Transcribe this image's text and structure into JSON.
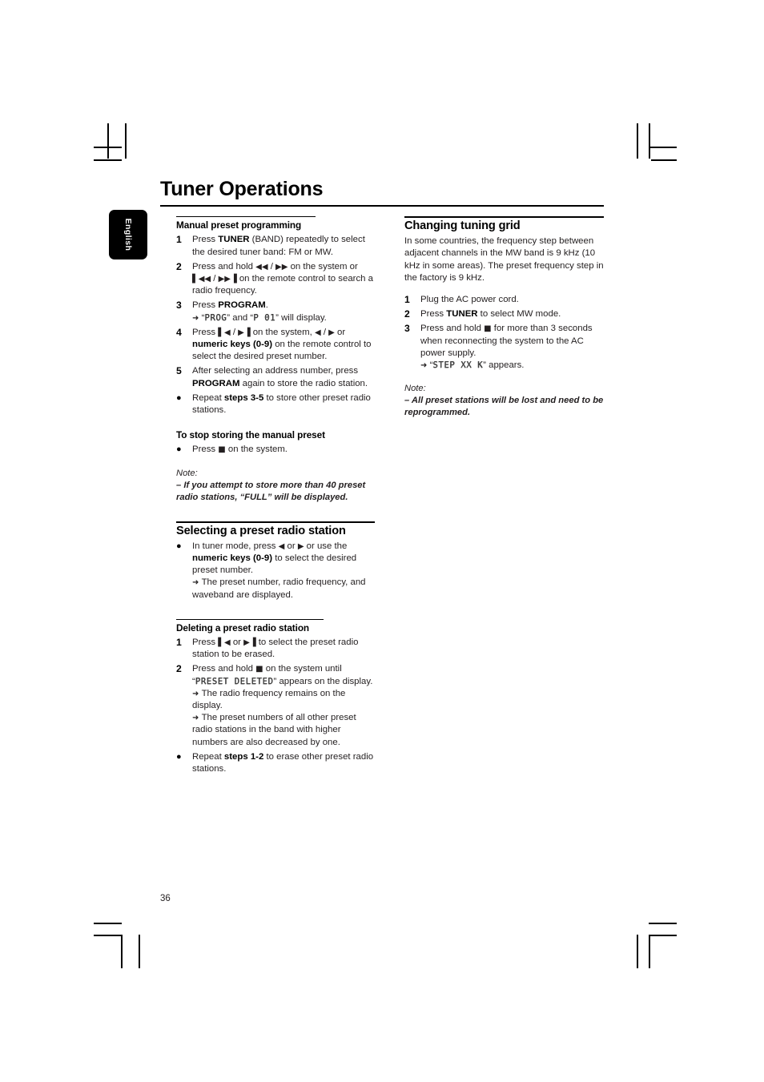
{
  "page": {
    "title": "Tuner Operations",
    "number": "36",
    "language_tab": "English"
  },
  "glyphs": {
    "arrow_right": "➜",
    "bullet": "●",
    "stop_square": "■",
    "rew": "◀◀",
    "ffwd": "▶▶",
    "prev_track": "▌◀◀",
    "next_track": "▶▶▐",
    "left": "◀",
    "right": "▶",
    "prev_single": "▌◀",
    "next_single": "▶▐",
    "dash": "–"
  },
  "left_column": {
    "heading": "Manual preset programming",
    "steps": [
      {
        "marker": "1",
        "segments": [
          {
            "t": "Press "
          },
          {
            "t": "TUNER",
            "bold": true
          },
          {
            "t": " (BAND) repeatedly to select the desired tuner band: FM or MW."
          }
        ]
      },
      {
        "marker": "2",
        "segments": [
          {
            "t": "Press and hold "
          },
          {
            "t": "◀◀",
            "glyph": true
          },
          {
            "t": " / "
          },
          {
            "t": "▶▶",
            "glyph": true
          },
          {
            "t": " on the system or "
          },
          {
            "t": "▌◀◀",
            "glyph": true
          },
          {
            "t": " / "
          },
          {
            "t": "▶▶▐",
            "glyph": true
          },
          {
            "t": " on the remote control to search a radio frequency."
          }
        ]
      },
      {
        "marker": "3",
        "segments": [
          {
            "t": "Press "
          },
          {
            "t": "PROGRAM",
            "bold": true
          },
          {
            "t": "."
          }
        ],
        "arrows": [
          {
            "segments": [
              {
                "t": "“"
              },
              {
                "t": "PROG",
                "lcd": true
              },
              {
                "t": "” and “"
              },
              {
                "t": "P 01",
                "lcd": true
              },
              {
                "t": "” will display."
              }
            ]
          }
        ]
      },
      {
        "marker": "4",
        "segments": [
          {
            "t": "Press "
          },
          {
            "t": "▌◀",
            "glyph": true
          },
          {
            "t": " / "
          },
          {
            "t": "▶▐",
            "glyph": true
          },
          {
            "t": " on the system, "
          },
          {
            "t": "◀",
            "glyph": true
          },
          {
            "t": " / "
          },
          {
            "t": "▶",
            "glyph": true
          },
          {
            "t": " or "
          },
          {
            "t": "numeric keys (0-9)",
            "bold": true
          },
          {
            "t": " on the remote control to select the desired preset number."
          }
        ]
      },
      {
        "marker": "5",
        "segments": [
          {
            "t": "After selecting an address number, press "
          },
          {
            "t": "PROGRAM",
            "bold": true
          },
          {
            "t": " again to store the radio station."
          }
        ]
      },
      {
        "marker": "●",
        "bullet": true,
        "segments": [
          {
            "t": "Repeat "
          },
          {
            "t": "steps 3-5",
            "bold": true
          },
          {
            "t": " to store other preset radio stations."
          }
        ]
      }
    ],
    "subheading_stop": "To stop storing the manual preset",
    "stop_step": {
      "marker": "●",
      "bullet": true,
      "segments": [
        {
          "t": "Press "
        },
        {
          "t": "■",
          "glyph": true
        },
        {
          "t": " on the system."
        }
      ]
    },
    "note1": {
      "head": "Note:",
      "body": "–  If you attempt to store more than 40 preset radio stations, “FULL” will be displayed."
    },
    "heading_selecting": "Selecting a preset radio station",
    "selecting_step": {
      "marker": "●",
      "bullet": true,
      "segments": [
        {
          "t": "In tuner mode, press "
        },
        {
          "t": "◀",
          "glyph": true
        },
        {
          "t": " or "
        },
        {
          "t": "▶",
          "glyph": true
        },
        {
          "t": " or use the "
        },
        {
          "t": "numeric keys (0-9)",
          "bold": true
        },
        {
          "t": " to select the desired preset number."
        }
      ],
      "arrows": [
        {
          "segments": [
            {
              "t": "The preset number, radio frequency, and waveband are displayed."
            }
          ]
        }
      ]
    },
    "heading_deleting": "Deleting a preset radio station",
    "deleting_steps": [
      {
        "marker": "1",
        "segments": [
          {
            "t": "Press "
          },
          {
            "t": "▌◀",
            "glyph": true
          },
          {
            "t": " or "
          },
          {
            "t": "▶▐",
            "glyph": true
          },
          {
            "t": " to select the preset radio station to be erased."
          }
        ]
      },
      {
        "marker": "2",
        "segments": [
          {
            "t": "Press and hold "
          },
          {
            "t": "■",
            "glyph": true
          },
          {
            "t": " on the system until  “"
          },
          {
            "t": "PRESET DELETED",
            "lcd": true
          },
          {
            "t": "” appears on the display."
          }
        ],
        "arrows": [
          {
            "segments": [
              {
                "t": "The radio frequency remains on the display."
              }
            ]
          },
          {
            "segments": [
              {
                "t": "The preset numbers of all other preset radio stations in the band with higher numbers are also decreased by one."
              }
            ]
          }
        ]
      },
      {
        "marker": "●",
        "bullet": true,
        "segments": [
          {
            "t": "Repeat "
          },
          {
            "t": "steps 1-2",
            "bold": true
          },
          {
            "t": " to erase other preset radio stations."
          }
        ]
      }
    ]
  },
  "right_column": {
    "heading": "Changing tuning grid",
    "intro": "In some countries, the frequency step between adjacent channels in the MW band is 9 kHz (10 kHz in some areas). The preset frequency step in the factory is 9 kHz.",
    "steps": [
      {
        "marker": "1",
        "segments": [
          {
            "t": "Plug the AC power cord."
          }
        ]
      },
      {
        "marker": "2",
        "segments": [
          {
            "t": "Press "
          },
          {
            "t": "TUNER",
            "bold": true
          },
          {
            "t": " to select MW mode."
          }
        ]
      },
      {
        "marker": "3",
        "segments": [
          {
            "t": "Press and hold "
          },
          {
            "t": "■",
            "glyph": true
          },
          {
            "t": " for more than 3 seconds when reconnecting the system to the AC power supply."
          }
        ],
        "arrows": [
          {
            "segments": [
              {
                "t": "“"
              },
              {
                "t": "STEP  XX K",
                "lcd": true
              },
              {
                "t": "” appears."
              }
            ]
          }
        ]
      }
    ],
    "note": {
      "head": "Note:",
      "body": "–  All preset stations will be lost and need to be reprogrammed."
    }
  }
}
